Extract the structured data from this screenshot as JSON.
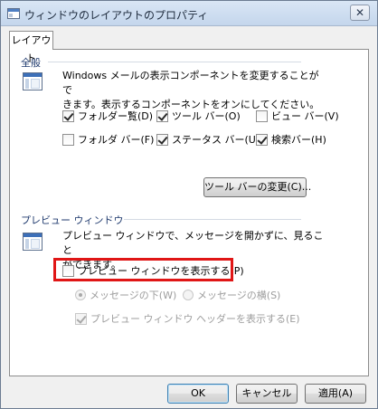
{
  "window": {
    "title": "ウィンドウのレイアウトのプロパティ",
    "close_glyph": "✕"
  },
  "tabs": [
    {
      "label": "レイアウト",
      "selected": true
    }
  ],
  "general": {
    "heading": "全般",
    "description_line1": "Windows メールの表示コンポーネントを変更することがで",
    "description_line2": "きます。表示するコンポーネントをオンにしてください。",
    "checkboxes": [
      {
        "label": "フォルダー覧(D)",
        "checked": true
      },
      {
        "label": "ツール バー(O)",
        "checked": true
      },
      {
        "label": "ビュー バー(V)",
        "checked": false
      },
      {
        "label": "フォルダ バー(F)",
        "checked": false
      },
      {
        "label": "ステータス バー(U)",
        "checked": true
      },
      {
        "label": "検索バー(H)",
        "checked": true
      }
    ],
    "toolbar_button": "ツール バーの変更(C)..."
  },
  "preview": {
    "heading": "プレビュー ウィンドウ",
    "description_line1": "プレビュー ウィンドウで、メッセージを開かずに、見ること",
    "description_line2": "ができます。",
    "show_checkbox": {
      "label": "プレビュー ウィンドウを表示する(P)",
      "checked": false
    },
    "radios": [
      {
        "label": "メッセージの下(W)",
        "selected": true,
        "enabled": false
      },
      {
        "label": "メッセージの横(S)",
        "selected": false,
        "enabled": false
      }
    ],
    "header_checkbox": {
      "label": "プレビュー ウィンドウ ヘッダーを表示する(E)",
      "checked": true,
      "enabled": false
    }
  },
  "footer": {
    "ok": "OK",
    "cancel": "キャンセル",
    "apply": "適用(A)"
  },
  "colors": {
    "highlight": "#e01616",
    "group_heading": "#1f3a6e"
  }
}
